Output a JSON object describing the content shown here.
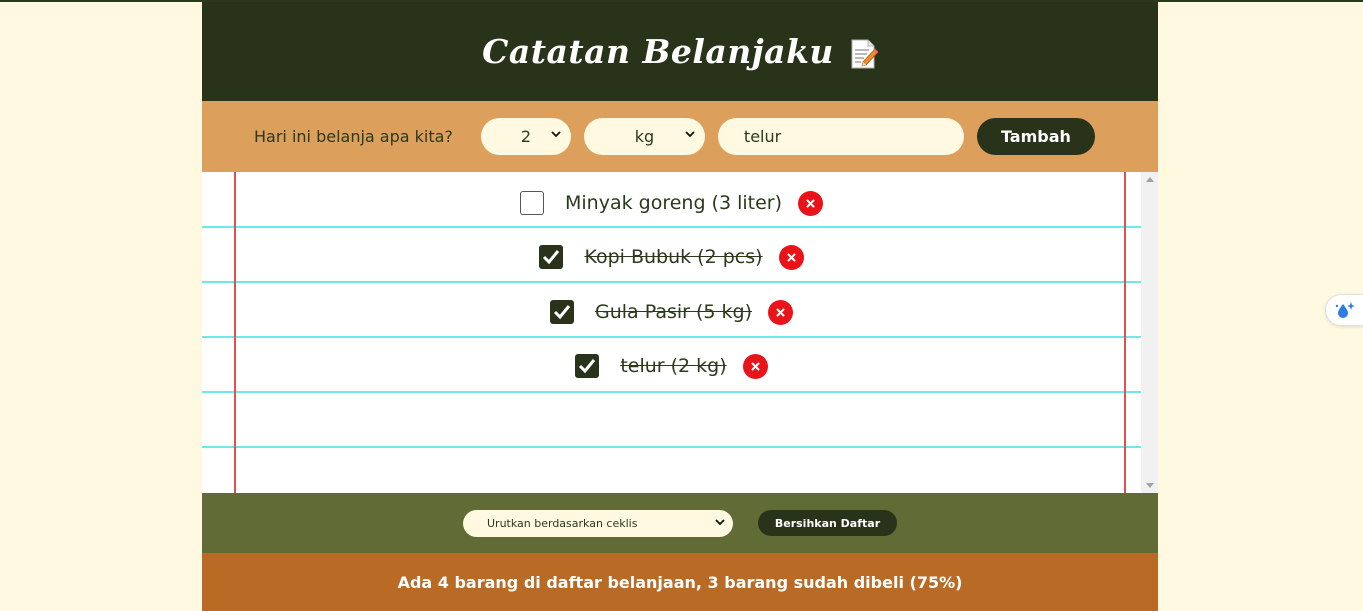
{
  "header": {
    "title": "Catatan Belanjaku",
    "icon": "memo-icon"
  },
  "form": {
    "prompt": "Hari ini belanja apa kita?",
    "quantity_value": "2",
    "unit_value": "kg",
    "item_value": "telur",
    "add_label": "Tambah"
  },
  "items": [
    {
      "text": "Minyak goreng (3 liter)",
      "checked": false
    },
    {
      "text": "Kopi Bubuk (2 pcs)",
      "checked": true
    },
    {
      "text": "Gula Pasir (5 kg)",
      "checked": true
    },
    {
      "text": "telur (2 kg)",
      "checked": true
    }
  ],
  "actions": {
    "sort_value": "Urutkan berdasarkan ceklis",
    "clear_label": "Bersihkan Daftar"
  },
  "stats": {
    "text": "Ada 4 barang di daftar belanjaan, 3 barang sudah dibeli (75%)"
  },
  "colors": {
    "header_bg": "#28331a",
    "form_bg": "#dc9f5c",
    "actions_bg": "#606b35",
    "stats_bg": "#b96b25",
    "delete_red": "#e8141a",
    "page_bg": "#fef9e0"
  }
}
